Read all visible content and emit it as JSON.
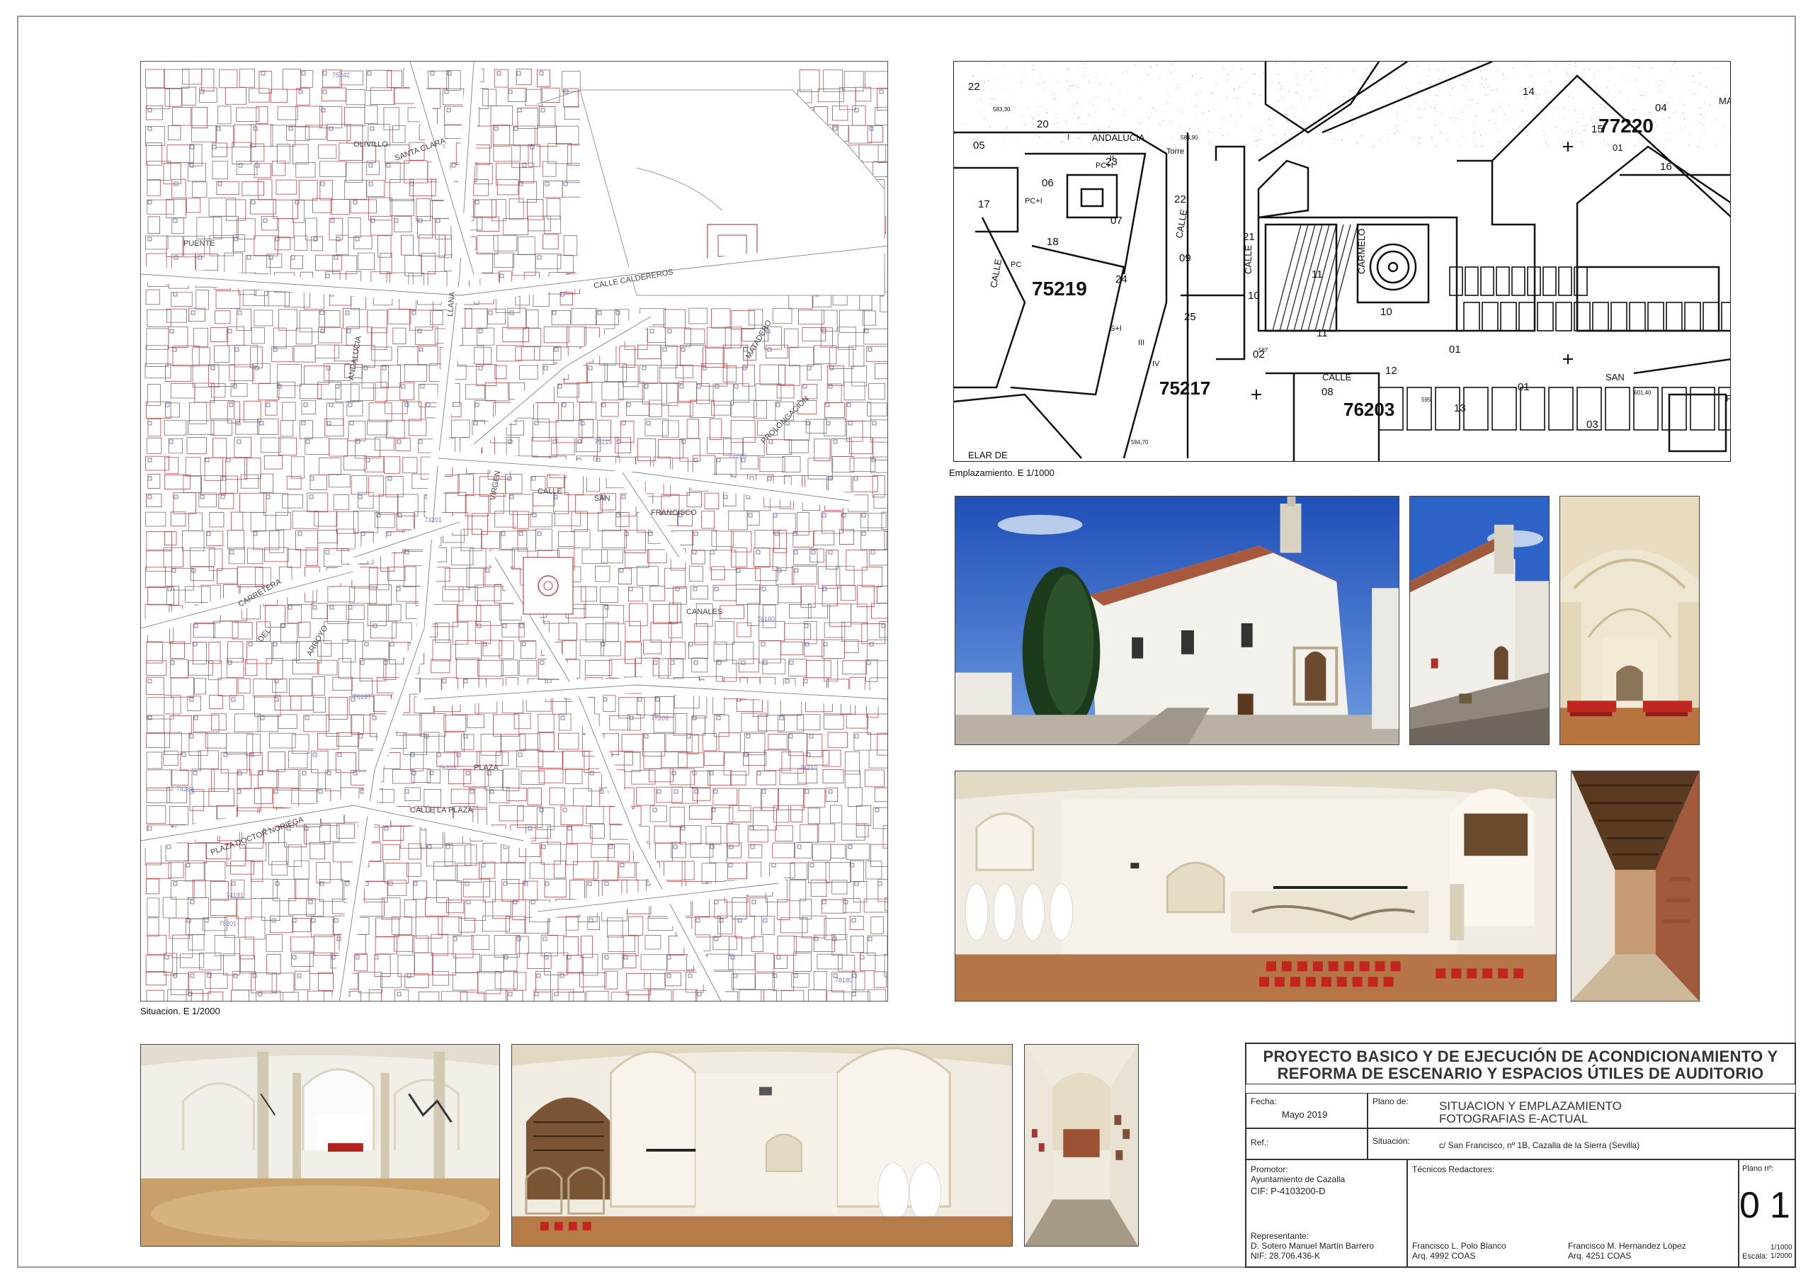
{
  "maps": {
    "situacion": {
      "caption": "Situacion. E 1/2000",
      "street_labels": [
        "ANDALUCIA",
        "CALLE CALDEREROS",
        "CALLE",
        "SAN",
        "FRANCISCO",
        "PUENTE",
        "LLANA",
        "VIRGEN",
        "CARRETERA",
        "DEL",
        "ARROYO",
        "PLAZA",
        "CALLE LA PLAZA",
        "PROLONGACION",
        "MATADERO",
        "CANALES",
        "SANTA CLARA",
        "OLIVILLO",
        "PLAZA DOCTOR NORIEGA"
      ],
      "block_codes": [
        "75242",
        "75219",
        "77220",
        "76203",
        "74283",
        "77209",
        "78210",
        "75201",
        "73201",
        "76180",
        "78180",
        "76197",
        "74181"
      ]
    },
    "emplazamiento": {
      "caption": "Emplazamiento. E 1/1000",
      "block_codes": [
        "77220",
        "75219",
        "75217",
        "76203"
      ],
      "street_labels": [
        "ANDALUCIA",
        "CALLE",
        "CALLE",
        "CALLE",
        "CALLE",
        "SAN",
        "FRANCISCO",
        "CARMELO",
        "TRAVESIA",
        "ELAR DE",
        "MA"
      ],
      "parcel_numbers": [
        "22",
        "20",
        "23",
        "22",
        "21",
        "11",
        "10",
        "01",
        "01",
        "03",
        "04",
        "05",
        "06",
        "07",
        "09",
        "10",
        "11",
        "12",
        "13",
        "14",
        "15",
        "16",
        "17",
        "18",
        "24",
        "25",
        "02",
        "08"
      ],
      "elevations": [
        "583,30",
        "584,90",
        "587",
        "584,70",
        "595",
        "601,40"
      ],
      "plant_marks": [
        "PC",
        "PC+I",
        "PC+I",
        "I",
        "II",
        "III",
        "IV",
        "S+I",
        "Torre"
      ]
    }
  },
  "title_block": {
    "title_line1": "PROYECTO BASICO Y DE EJECUCIÓN DE ACONDICIONAMIENTO Y",
    "title_line2": "REFORMA DE ESCENARIO Y ESPACIOS ÚTILES DE AUDITORIO",
    "fecha_label": "Fecha:",
    "fecha_value": "Mayo 2019",
    "plano_de_label": "Plano de:",
    "plano_de_line1": "SITUACION Y EMPLAZAMIENTO",
    "plano_de_line2": "FOTOGRAFIAS E-ACTUAL",
    "ref_label": "Ref.:",
    "situacion_label": "Situación:",
    "situacion_value": "c/ San Francisco, nº 1B,   Cazalla de la Sierra (Sevilla)",
    "promotor_label": "Promotor:",
    "promotor_name": "Ayuntamiento de Cazalla",
    "promotor_cif": "CIF:  P-4103200-D",
    "representante_label": "Representante:",
    "representante_name": "D. Sotero Manuel Martín Barrero",
    "representante_nif": "NIF: 28.706.436-K",
    "tecnicos_label": "Técnicos Redactores:",
    "tecnico1_name": "Francisco L. Polo Blanco",
    "tecnico1_id": "Arq. 4992 COAS",
    "tecnico2_name": "Francisco M. Hernandez López",
    "tecnico2_id": "Arq. 4251 COAS",
    "plano_n_label": "Plano nº:",
    "plano_n_value": "01",
    "escala_label": "Escala:",
    "escala_value1": "1/1000",
    "escala_value2": "1/2000"
  },
  "photos": [
    {
      "name": "church-exterior-photo",
      "subject": "church exterior with cypress"
    },
    {
      "name": "church-street-photo",
      "subject": "church side street"
    },
    {
      "name": "nave-interior-photo",
      "subject": "vaulted nave with red chairs"
    },
    {
      "name": "auditorium-panorama-photo",
      "subject": "auditorium panorama"
    },
    {
      "name": "corridor-ceiling-photo",
      "subject": "corridor with wooden ceiling"
    },
    {
      "name": "cloister-columns-photo",
      "subject": "arcade with columns"
    },
    {
      "name": "interior-panorama-photo",
      "subject": "interior panorama with tanks"
    },
    {
      "name": "narrow-gallery-photo",
      "subject": "narrow gallery"
    }
  ],
  "colors": {
    "map_line_red": "#b84a4a",
    "map_line_blue": "#5a5ab0",
    "border": "#555555",
    "title_text": "#333333"
  }
}
